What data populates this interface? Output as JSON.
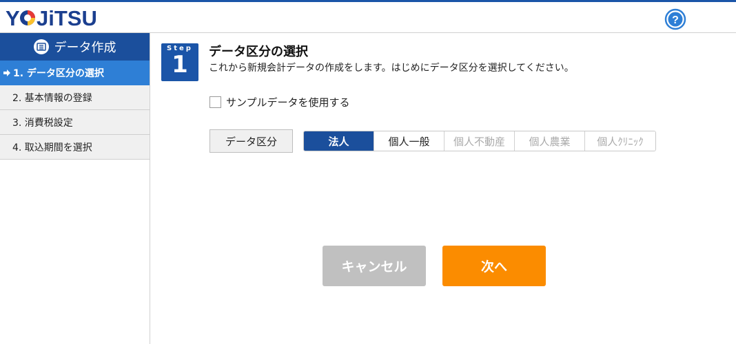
{
  "app": {
    "logo_text": "YOJITSU"
  },
  "colors": {
    "brand": "#1b55a8",
    "active_item": "#2e7fd6",
    "next_button": "#fb8c00",
    "cancel_button": "#c0c0c0"
  },
  "sidebar": {
    "title": "データ作成",
    "items": [
      {
        "label": "1. データ区分の選択",
        "active": true
      },
      {
        "label": "2. 基本情報の登録",
        "active": false
      },
      {
        "label": "3. 消費税設定",
        "active": false
      },
      {
        "label": "4. 取込期間を選択",
        "active": false
      }
    ]
  },
  "step": {
    "label": "Step",
    "number": "1"
  },
  "main": {
    "title": "データ区分の選択",
    "description": "これから新規会計データの作成をします。はじめにデータ区分を選択してください。",
    "sample_checkbox_label": "サンプルデータを使用する",
    "sample_checked": false,
    "kubun_label": "データ区分",
    "segments": [
      {
        "label": "法人",
        "state": "selected"
      },
      {
        "label": "個人一般",
        "state": "enabled"
      },
      {
        "label": "個人不動産",
        "state": "disabled"
      },
      {
        "label": "個人農業",
        "state": "disabled"
      },
      {
        "label": "個人ｸﾘﾆｯｸ",
        "state": "disabled"
      }
    ]
  },
  "buttons": {
    "cancel": "キャンセル",
    "next": "次へ"
  }
}
